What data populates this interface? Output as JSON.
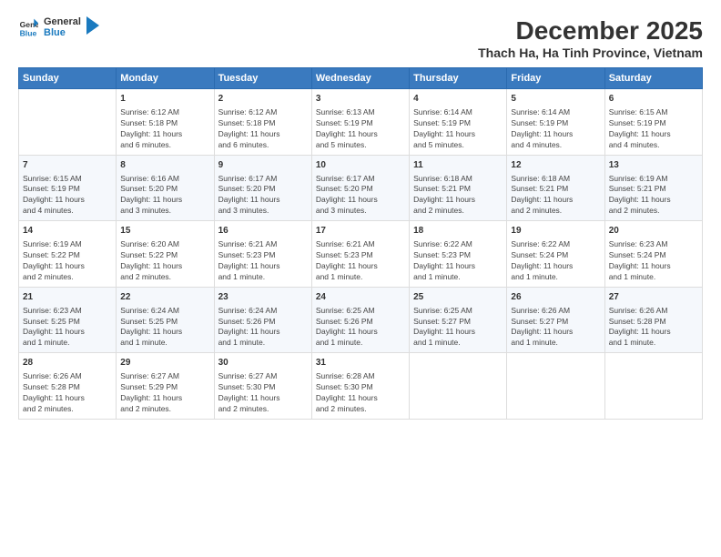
{
  "logo": {
    "line1": "General",
    "line2": "Blue",
    "icon_color": "#1a7abf"
  },
  "title": "December 2025",
  "subtitle": "Thach Ha, Ha Tinh Province, Vietnam",
  "days_of_week": [
    "Sunday",
    "Monday",
    "Tuesday",
    "Wednesday",
    "Thursday",
    "Friday",
    "Saturday"
  ],
  "weeks": [
    [
      {
        "day": "",
        "info": ""
      },
      {
        "day": "1",
        "info": "Sunrise: 6:12 AM\nSunset: 5:18 PM\nDaylight: 11 hours\nand 6 minutes."
      },
      {
        "day": "2",
        "info": "Sunrise: 6:12 AM\nSunset: 5:18 PM\nDaylight: 11 hours\nand 6 minutes."
      },
      {
        "day": "3",
        "info": "Sunrise: 6:13 AM\nSunset: 5:19 PM\nDaylight: 11 hours\nand 5 minutes."
      },
      {
        "day": "4",
        "info": "Sunrise: 6:14 AM\nSunset: 5:19 PM\nDaylight: 11 hours\nand 5 minutes."
      },
      {
        "day": "5",
        "info": "Sunrise: 6:14 AM\nSunset: 5:19 PM\nDaylight: 11 hours\nand 4 minutes."
      },
      {
        "day": "6",
        "info": "Sunrise: 6:15 AM\nSunset: 5:19 PM\nDaylight: 11 hours\nand 4 minutes."
      }
    ],
    [
      {
        "day": "7",
        "info": "Sunrise: 6:15 AM\nSunset: 5:19 PM\nDaylight: 11 hours\nand 4 minutes."
      },
      {
        "day": "8",
        "info": "Sunrise: 6:16 AM\nSunset: 5:20 PM\nDaylight: 11 hours\nand 3 minutes."
      },
      {
        "day": "9",
        "info": "Sunrise: 6:17 AM\nSunset: 5:20 PM\nDaylight: 11 hours\nand 3 minutes."
      },
      {
        "day": "10",
        "info": "Sunrise: 6:17 AM\nSunset: 5:20 PM\nDaylight: 11 hours\nand 3 minutes."
      },
      {
        "day": "11",
        "info": "Sunrise: 6:18 AM\nSunset: 5:21 PM\nDaylight: 11 hours\nand 2 minutes."
      },
      {
        "day": "12",
        "info": "Sunrise: 6:18 AM\nSunset: 5:21 PM\nDaylight: 11 hours\nand 2 minutes."
      },
      {
        "day": "13",
        "info": "Sunrise: 6:19 AM\nSunset: 5:21 PM\nDaylight: 11 hours\nand 2 minutes."
      }
    ],
    [
      {
        "day": "14",
        "info": "Sunrise: 6:19 AM\nSunset: 5:22 PM\nDaylight: 11 hours\nand 2 minutes."
      },
      {
        "day": "15",
        "info": "Sunrise: 6:20 AM\nSunset: 5:22 PM\nDaylight: 11 hours\nand 2 minutes."
      },
      {
        "day": "16",
        "info": "Sunrise: 6:21 AM\nSunset: 5:23 PM\nDaylight: 11 hours\nand 1 minute."
      },
      {
        "day": "17",
        "info": "Sunrise: 6:21 AM\nSunset: 5:23 PM\nDaylight: 11 hours\nand 1 minute."
      },
      {
        "day": "18",
        "info": "Sunrise: 6:22 AM\nSunset: 5:23 PM\nDaylight: 11 hours\nand 1 minute."
      },
      {
        "day": "19",
        "info": "Sunrise: 6:22 AM\nSunset: 5:24 PM\nDaylight: 11 hours\nand 1 minute."
      },
      {
        "day": "20",
        "info": "Sunrise: 6:23 AM\nSunset: 5:24 PM\nDaylight: 11 hours\nand 1 minute."
      }
    ],
    [
      {
        "day": "21",
        "info": "Sunrise: 6:23 AM\nSunset: 5:25 PM\nDaylight: 11 hours\nand 1 minute."
      },
      {
        "day": "22",
        "info": "Sunrise: 6:24 AM\nSunset: 5:25 PM\nDaylight: 11 hours\nand 1 minute."
      },
      {
        "day": "23",
        "info": "Sunrise: 6:24 AM\nSunset: 5:26 PM\nDaylight: 11 hours\nand 1 minute."
      },
      {
        "day": "24",
        "info": "Sunrise: 6:25 AM\nSunset: 5:26 PM\nDaylight: 11 hours\nand 1 minute."
      },
      {
        "day": "25",
        "info": "Sunrise: 6:25 AM\nSunset: 5:27 PM\nDaylight: 11 hours\nand 1 minute."
      },
      {
        "day": "26",
        "info": "Sunrise: 6:26 AM\nSunset: 5:27 PM\nDaylight: 11 hours\nand 1 minute."
      },
      {
        "day": "27",
        "info": "Sunrise: 6:26 AM\nSunset: 5:28 PM\nDaylight: 11 hours\nand 1 minute."
      }
    ],
    [
      {
        "day": "28",
        "info": "Sunrise: 6:26 AM\nSunset: 5:28 PM\nDaylight: 11 hours\nand 2 minutes."
      },
      {
        "day": "29",
        "info": "Sunrise: 6:27 AM\nSunset: 5:29 PM\nDaylight: 11 hours\nand 2 minutes."
      },
      {
        "day": "30",
        "info": "Sunrise: 6:27 AM\nSunset: 5:30 PM\nDaylight: 11 hours\nand 2 minutes."
      },
      {
        "day": "31",
        "info": "Sunrise: 6:28 AM\nSunset: 5:30 PM\nDaylight: 11 hours\nand 2 minutes."
      },
      {
        "day": "",
        "info": ""
      },
      {
        "day": "",
        "info": ""
      },
      {
        "day": "",
        "info": ""
      }
    ]
  ]
}
